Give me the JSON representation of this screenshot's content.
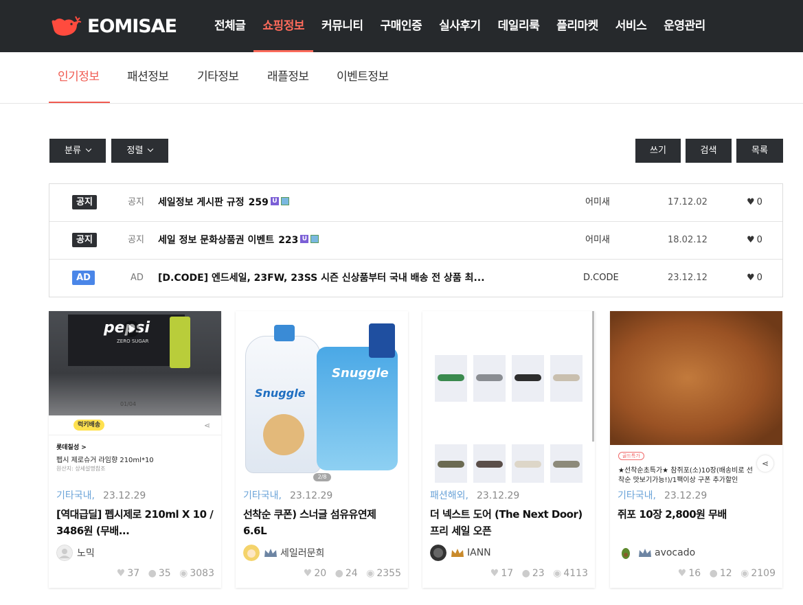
{
  "brand": {
    "name": "EOMISAE"
  },
  "gnav": [
    "전체글",
    "쇼핑정보",
    "커뮤니티",
    "구매인증",
    "실사후기",
    "데일리룩",
    "플리마켓",
    "서비스",
    "운영관리"
  ],
  "gnav_active": "쇼핑정보",
  "subnav": [
    "인기정보",
    "패션정보",
    "기타정보",
    "래플정보",
    "이벤트정보"
  ],
  "toolbar": {
    "category": "분류",
    "sort": "정렬",
    "write": "쓰기",
    "search": "검색",
    "list": "목록"
  },
  "notices": [
    {
      "badge": "공지",
      "cat": "공지",
      "title": "세일정보 게시판 규정",
      "count": "259",
      "author": "어미새",
      "date": "17.12.02",
      "likes": "0"
    },
    {
      "badge": "공지",
      "cat": "공지",
      "title": "세일 정보 문화상품권 이벤트",
      "count": "223",
      "author": "어미새",
      "date": "18.02.12",
      "likes": "0"
    },
    {
      "badge": "AD",
      "cat": "AD",
      "title": "[D.CODE] 엔드세일, 23FW, 23SS 시즌 신상품부터 국내 배송 전 상품 최...",
      "count": "",
      "author": "D.CODE",
      "date": "23.12.12",
      "likes": "0"
    }
  ],
  "cards": [
    {
      "cat": "기타국내,",
      "date": "23.12.29",
      "title": "[역대급딜] 펩시제로 210ml X 10 / 3486원 (무배...",
      "author": "노믹",
      "likes": "37",
      "comments": "35",
      "views": "3083",
      "thumb": {
        "brand": "pepsi",
        "sub": "ZERO SUGAR",
        "counter": "01/04",
        "badge": "럭키배송",
        "store": "롯데칠성 >",
        "product": "펩시 제로슈거 라임향 210ml*10",
        "origin": "원산지: 상세설명참조"
      }
    },
    {
      "cat": "기타국내,",
      "date": "23.12.29",
      "title": "선착순 쿠폰) 스너글 섬유유연제 6.6L",
      "author": "세일러문희",
      "likes": "20",
      "comments": "24",
      "views": "2355",
      "thumb": {
        "brand": "Snuggle",
        "counter": "2/8"
      }
    },
    {
      "cat": "패션해외,",
      "date": "23.12.29",
      "title": "더 넥스트 도어 (The Next Door) 프리 세일 오픈",
      "author": "IANN",
      "likes": "17",
      "comments": "23",
      "views": "4113",
      "thumb": {}
    },
    {
      "cat": "기타국내,",
      "date": "23.12.29",
      "title": "쥐포 10장 2,800원 무배",
      "author": "avocado",
      "likes": "16",
      "comments": "12",
      "views": "2109",
      "thumb": {
        "tag": "골드특가",
        "caption": "★선착순초특가★ 참쥐포(소)10장(배송비로 선착순 맛보기가능!)/1팩이상 구폰 추가할인"
      }
    }
  ],
  "colors": {
    "accent": "#f05a50",
    "dark": "#26292c",
    "cat_blue": "#6aa3d8",
    "ad_blue": "#4a86e8"
  }
}
